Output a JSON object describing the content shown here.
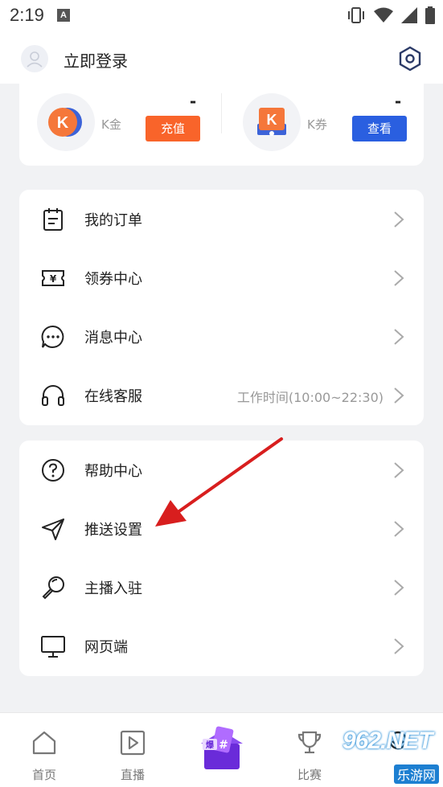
{
  "status_bar": {
    "time": "2:19",
    "notification_badge": "A"
  },
  "header": {
    "login_text": "立即登录"
  },
  "wallet": {
    "k_gold": {
      "label": "K金",
      "value": "-",
      "button": "充值",
      "button_color": "#f9642a",
      "coin_letter": "K"
    },
    "k_coupon": {
      "label": "K券",
      "value": "-",
      "button": "查看",
      "button_color": "#2a5fe0",
      "coin_letter": "K"
    }
  },
  "menu_group_1": [
    {
      "label": "我的订单",
      "icon": "order-icon",
      "sub": ""
    },
    {
      "label": "领券中心",
      "icon": "coupon-icon",
      "sub": ""
    },
    {
      "label": "消息中心",
      "icon": "message-icon",
      "sub": ""
    },
    {
      "label": "在线客服",
      "icon": "headset-icon",
      "sub": "工作时间(10:00~22:30)"
    }
  ],
  "menu_group_2": [
    {
      "label": "帮助中心",
      "icon": "help-icon"
    },
    {
      "label": "推送设置",
      "icon": "send-icon"
    },
    {
      "label": "主播入驻",
      "icon": "streamer-icon"
    },
    {
      "label": "网页端",
      "icon": "monitor-icon"
    }
  ],
  "tabbar": {
    "items": [
      {
        "label": "首页",
        "icon": "home-icon"
      },
      {
        "label": "直播",
        "icon": "play-icon"
      },
      {
        "label": "",
        "icon": "center-promo-icon"
      },
      {
        "label": "比赛",
        "icon": "trophy-icon"
      },
      {
        "label": "",
        "icon": "profile-icon"
      }
    ]
  },
  "watermark": {
    "text": "962.NET",
    "sub": "乐游网"
  },
  "colors": {
    "accent_orange": "#f9642a",
    "accent_blue": "#2a5fe0",
    "annotation_arrow": "#d81e1e"
  }
}
